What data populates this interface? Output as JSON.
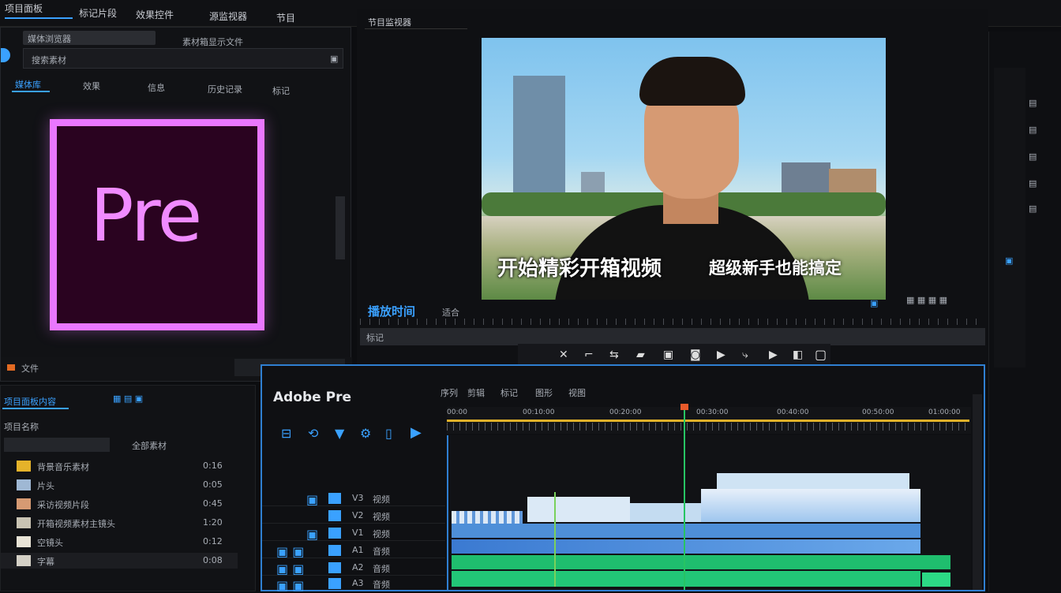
{
  "menu": {
    "items": [
      "项目面板",
      "标记片段",
      "效果控件",
      "源监视器",
      "节目"
    ],
    "left_field": "媒体浏览器",
    "tabs": [
      "媒体库",
      "效果",
      "信息",
      "历史记录",
      "标记"
    ]
  },
  "source_panel": {
    "tab_label": "素材箱显示文件",
    "search_label": "搜索素材",
    "logo_text": "Pre",
    "footer_label": "文件"
  },
  "program_monitor": {
    "tab_label": "节目监视器",
    "timecode": "播放时间",
    "fit_label": "适合",
    "caption_main": "开始精彩开箱视频",
    "caption_right": "超级新手也能搞定",
    "ruler_label": "标记"
  },
  "transport": {
    "buttons": [
      "mark-in",
      "mark-out",
      "step-back",
      "export-frame",
      "loop",
      "play",
      "step-forward",
      "lift",
      "extract",
      "settings"
    ]
  },
  "project": {
    "tab_label": "项目面板内容",
    "header": "项目名称",
    "filter": "全部素材",
    "items": [
      {
        "name": "背景音乐素材",
        "time": "0:16"
      },
      {
        "name": "片头",
        "time": "0:05"
      },
      {
        "name": "采访视频片段",
        "time": "0:45"
      },
      {
        "name": "开箱视频素材主镜头",
        "time": "1:20"
      },
      {
        "name": "空镜头",
        "time": "0:12"
      },
      {
        "name": "字幕",
        "time": "0:08"
      }
    ]
  },
  "timeline": {
    "title": "Adobe Pre",
    "menu": [
      "序列",
      "剪辑",
      "标记",
      "图形",
      "视图"
    ],
    "ruler_marks": [
      "00:00",
      "00:10:00",
      "00:20:00",
      "00:30:00",
      "00:40:00",
      "00:50:00",
      "01:00:00"
    ],
    "tracks": [
      {
        "name": "V3",
        "label": "视频"
      },
      {
        "name": "V2",
        "label": "视频"
      },
      {
        "name": "V1",
        "label": "视频"
      },
      {
        "name": "A1",
        "label": "音频"
      },
      {
        "name": "A2",
        "label": "音频"
      },
      {
        "name": "A3",
        "label": "音频"
      }
    ]
  },
  "colors": {
    "accent": "#3aa1ff",
    "logo_pink": "#ea77ff",
    "clip_blue": "#4e8fd8",
    "clip_green": "#1fbe6e",
    "playhead": "#27c463",
    "work_area": "#e0b12a"
  }
}
